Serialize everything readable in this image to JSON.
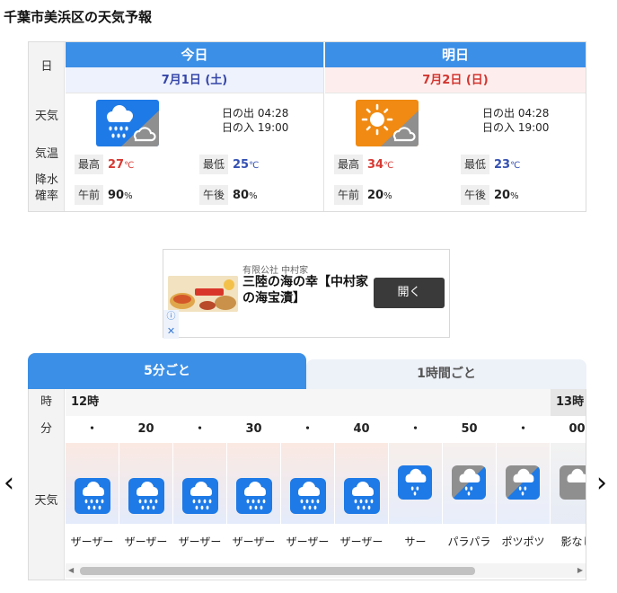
{
  "page": {
    "title": "千葉市美浜区の天気予報"
  },
  "daily": {
    "row_labels": {
      "day": "日",
      "weather": "天気",
      "temp": "気温",
      "precip_1": "降水",
      "precip_2": "確率"
    },
    "days": [
      {
        "heading": "今日",
        "date": "7月1日 (土)",
        "weather_icon": "rain-then-cloudy-icon",
        "sunrise": "日の出 04:28",
        "sunset": "日の入 19:00",
        "high_label": "最高",
        "high": "27",
        "low_label": "最低",
        "low": "25",
        "temp_unit": "℃",
        "am_label": "午前",
        "am_precip": "90",
        "pm_label": "午後",
        "pm_precip": "80",
        "precip_unit": "%"
      },
      {
        "heading": "明日",
        "date": "7月2日 (日)",
        "weather_icon": "sunny-then-cloudy-icon",
        "sunrise": "日の出 04:28",
        "sunset": "日の入 19:00",
        "high_label": "最高",
        "high": "34",
        "low_label": "最低",
        "low": "23",
        "temp_unit": "℃",
        "am_label": "午前",
        "am_precip": "20",
        "pm_label": "午後",
        "pm_precip": "20",
        "precip_unit": "%"
      }
    ]
  },
  "ad": {
    "sponsor": "有限公社 中村家",
    "title": "三陸の海の幸【中村家の海宝漬】",
    "button": "開く",
    "info_icon": "ⓘ",
    "close_icon": "✕"
  },
  "nowcast": {
    "tabs": [
      "5分ごと",
      "1時間ごと"
    ],
    "row_labels": {
      "hour": "時",
      "minute": "分",
      "weather": "天気"
    },
    "hours": [
      "12時",
      "13時"
    ],
    "columns": [
      {
        "minute": "・",
        "icon": "heavy-rain-icon",
        "desc": "ザーザー"
      },
      {
        "minute": "20",
        "icon": "heavy-rain-icon",
        "desc": "ザーザー"
      },
      {
        "minute": "・",
        "icon": "heavy-rain-icon",
        "desc": "ザーザー"
      },
      {
        "minute": "30",
        "icon": "heavy-rain-icon",
        "desc": "ザーザー"
      },
      {
        "minute": "・",
        "icon": "heavy-rain-icon",
        "desc": "ザーザー"
      },
      {
        "minute": "40",
        "icon": "heavy-rain-icon",
        "desc": "ザーザー"
      },
      {
        "minute": "・",
        "icon": "rain-icon",
        "desc": "サー"
      },
      {
        "minute": "50",
        "icon": "light-rain-cloudy-icon",
        "desc": "パラパラ"
      },
      {
        "minute": "・",
        "icon": "light-rain-cloudy-icon",
        "desc": "ポツポツ"
      },
      {
        "minute": "00",
        "icon": "cloudy-icon",
        "desc": "影なし"
      }
    ]
  },
  "colors": {
    "accent": "#3c8fe6",
    "rain_blue": "#1e7ae6",
    "sun_orange": "#f08a12",
    "cloud_gray": "#8f8f8f"
  }
}
